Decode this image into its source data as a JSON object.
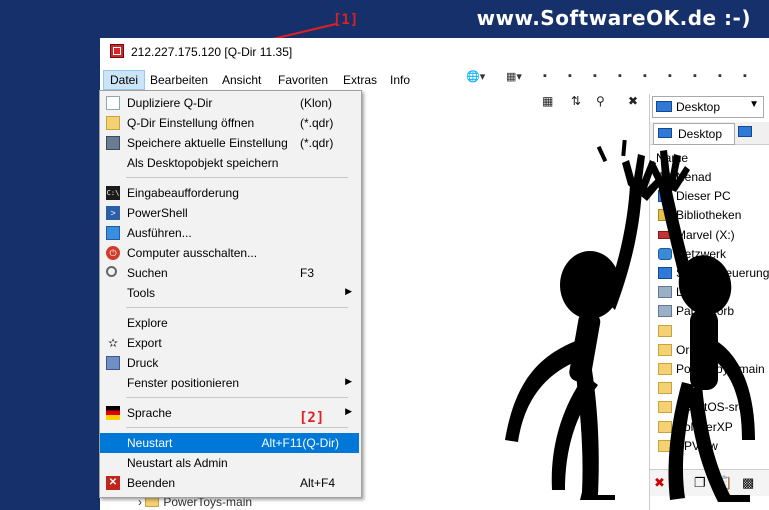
{
  "brand": "www.SoftwareOK.de :-)",
  "annotations": {
    "a1": "[1]",
    "a2": "[2]"
  },
  "window": {
    "title": "212.227.175.120  [Q-Dir 11.35]"
  },
  "menubar": [
    {
      "label": "Datei",
      "active": true
    },
    {
      "label": "Bearbeiten"
    },
    {
      "label": "Ansicht"
    },
    {
      "label": "Favoriten"
    },
    {
      "label": "Extras"
    },
    {
      "label": "Info"
    }
  ],
  "datei_menu": [
    {
      "label": "Dupliziere Q-Dir",
      "shortcut": "(Klon)",
      "icon": "doc-icon"
    },
    {
      "label": "Q-Dir Einstellung öffnen",
      "shortcut": "(*.qdr)",
      "icon": "folder-icon"
    },
    {
      "label": "Speichere  aktuelle Einstellung",
      "shortcut": "(*.qdr)",
      "icon": "save-icon"
    },
    {
      "label": "Als Desktopobjekt speichern",
      "shortcut": "",
      "icon": ""
    },
    {
      "separator": true
    },
    {
      "label": "Eingabeaufforderung",
      "shortcut": "",
      "icon": "cmd-icon"
    },
    {
      "label": "PowerShell",
      "shortcut": "",
      "icon": "powershell-icon"
    },
    {
      "label": "Ausführen...",
      "shortcut": "",
      "icon": "run-icon"
    },
    {
      "label": "Computer ausschalten...",
      "shortcut": "",
      "icon": "power-icon"
    },
    {
      "label": "Suchen",
      "shortcut": "F3",
      "icon": "search-icon"
    },
    {
      "label": "Tools",
      "shortcut": "",
      "icon": "",
      "submenu": true
    },
    {
      "separator": true
    },
    {
      "label": "Explore",
      "shortcut": "",
      "icon": ""
    },
    {
      "label": "Export",
      "shortcut": "",
      "icon": "export-icon"
    },
    {
      "label": "Druck",
      "shortcut": "",
      "icon": "printer-icon"
    },
    {
      "label": "Fenster positionieren",
      "shortcut": "",
      "icon": "",
      "submenu": true
    },
    {
      "separator": true
    },
    {
      "label": "Sprache",
      "shortcut": "",
      "icon": "flag-icon",
      "submenu": true
    },
    {
      "separator": true
    },
    {
      "label": "Neustart",
      "shortcut": "Alt+F11(Q-Dir)",
      "icon": "",
      "highlighted": true
    },
    {
      "label": "Neustart als Admin",
      "shortcut": "",
      "icon": ""
    },
    {
      "label": "Beenden",
      "shortcut": "Alt+F4",
      "icon": "close-icon"
    }
  ],
  "right_panel": {
    "address": "Desktop",
    "tab": "Desktop",
    "column": "Name",
    "items": [
      {
        "label": "Nenad",
        "icon": "user"
      },
      {
        "label": "Dieser PC",
        "icon": "pc"
      },
      {
        "label": "Bibliotheken",
        "icon": "lib"
      },
      {
        "label": "Marvel (X:)",
        "icon": "drive"
      },
      {
        "label": "Netzwerk",
        "icon": "net"
      },
      {
        "label": "Systemsteuerung",
        "icon": "pc"
      },
      {
        "label": "Löschen",
        "icon": "bin"
      },
      {
        "label": "Papierkorb",
        "icon": "bin"
      },
      {
        "label": "",
        "icon": "folder"
      },
      {
        "label": "Ordner",
        "icon": "folder"
      },
      {
        "label": "PowerToys-main",
        "icon": "folder"
      },
      {
        "label": "",
        "icon": "folder"
      },
      {
        "label": "ReactOS-src",
        "icon": "folder"
      },
      {
        "label": "SolitaerXP",
        "icon": "folder"
      },
      {
        "label": "SPView",
        "icon": "folder"
      }
    ]
  },
  "tree_item": "PowerToys-main"
}
